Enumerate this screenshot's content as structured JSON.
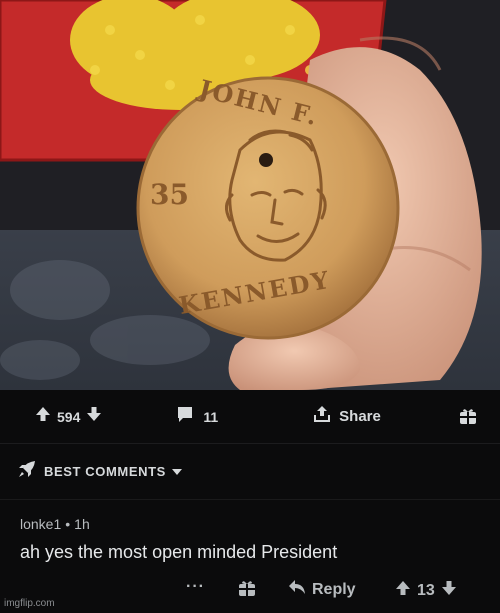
{
  "post": {
    "cookie_text_top": "JOHN F.",
    "cookie_number": "35",
    "cookie_text_bottom": "KENNEDY"
  },
  "action_bar": {
    "vote_count": "594",
    "comment_count": "11",
    "share_label": "Share"
  },
  "sort": {
    "label": "BEST COMMENTS"
  },
  "comment": {
    "author": "lonke1",
    "separator": "•",
    "age": "1h",
    "body": "ah yes the most open minded President",
    "more_label": "···",
    "reply_label": "Reply",
    "vote_count": "13"
  },
  "watermark": "imgflip.com",
  "colors": {
    "background": "#000000",
    "bar_background": "#0b0b0c",
    "text": "#d7dadc",
    "muted_text": "#b8bcbf"
  }
}
